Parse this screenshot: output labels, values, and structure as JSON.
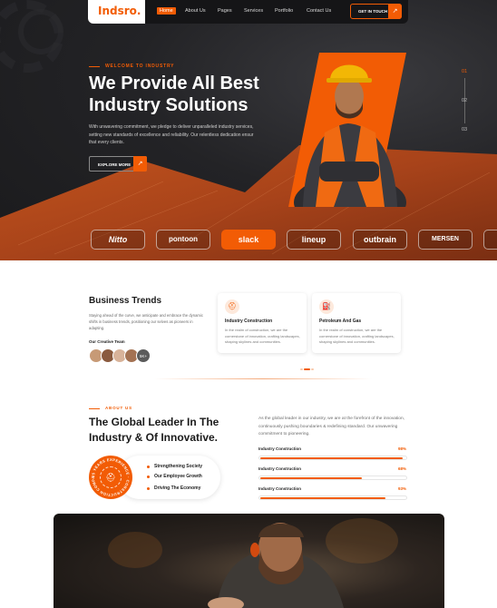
{
  "header": {
    "logo": "Indsro.",
    "nav": [
      "Home",
      "About Us",
      "Pages",
      "Services",
      "Portfolio",
      "Contact Us"
    ],
    "cta_label": "GET IN TOUCH",
    "cta_arrow": "↗"
  },
  "hero": {
    "eyebrow": "WELCOME TO INDUSTRY",
    "title": "We Provide All Best Industry Solutions",
    "description": "With unwavering commitment, we pledge to deliver unparalleled industry services, setting new standards of excellence and reliability. Our relentless dedication ensur that every clients.",
    "button_label": "EXPLORE MORE",
    "button_arrow": "↗",
    "slides": [
      "01",
      "02",
      "03"
    ]
  },
  "brands": [
    "Nitto",
    "pontoon",
    "slack",
    "lineup",
    "outbrain",
    "MERSEN"
  ],
  "trends": {
    "title": "Business Trends",
    "description": "Staying ahead of the curve, we anticipate and embrace the dynamic shifts in business trends, positioning our selves as pioneers in adapting.",
    "team_label": "Our Creative Team",
    "team_more": "5K+",
    "cards": [
      {
        "title": "Industry Construction",
        "desc": "In the realm of construction, we are the cornerstone of innovation, crafting landscapes, shaping skylines and communities."
      },
      {
        "title": "Petroleum And Gas",
        "desc": "In the realm of construction, we are the cornerstone of innovation, crafting landscapes, shaping skylines and communities."
      }
    ]
  },
  "about": {
    "eyebrow": "ABOUT US",
    "title": "The Global Leader In The Industry & Of Innovative.",
    "description": "As the global leader in our industry, we are at the forefront of the innovation, continuously pushing boundaries & redefining standard. Our unwavering commitment to pioneering.",
    "badge_text": "25 YEARS EXPERIENCE · CONSTRUCTION COMPANY ·",
    "bullets": [
      "Strengthening Society",
      "Our Employee Growth",
      "Driving The Economy"
    ],
    "progress": [
      {
        "label": "Industry Construction",
        "percent": 98
      },
      {
        "label": "Industry Construction",
        "percent": 70
      },
      {
        "label": "Industry Construction",
        "percent": 86
      }
    ],
    "progress_labels": [
      "98%",
      "68%",
      "93%"
    ]
  },
  "colors": {
    "accent": "#f25c05",
    "dark": "#1f1f22"
  }
}
